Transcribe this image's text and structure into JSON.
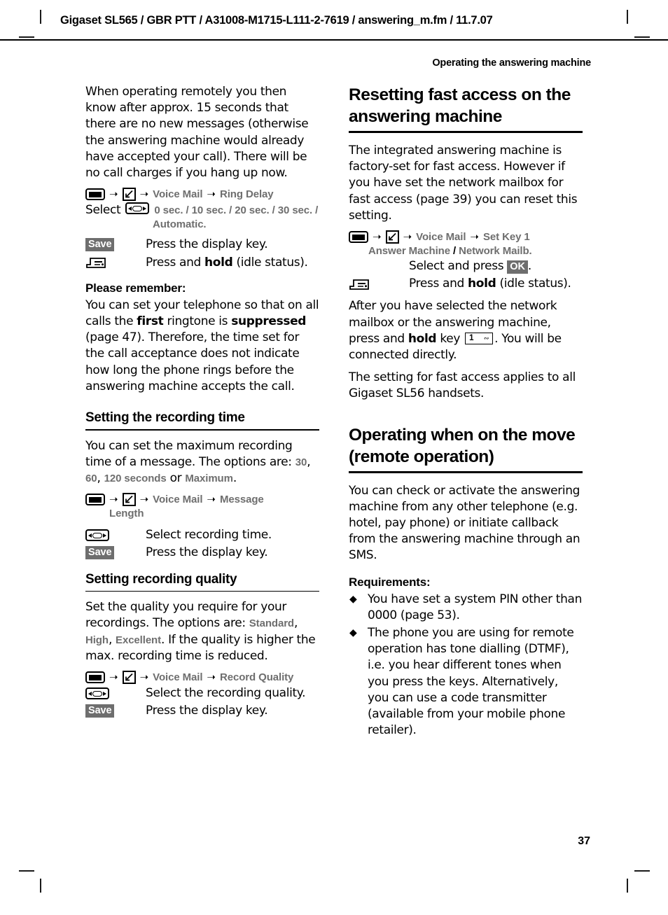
{
  "page": {
    "header_line": "Gigaset SL565 / GBR PTT / A31008-M1715-L111-2-7619 / answering_m.fm / 11.7.07",
    "running_section": "Operating the answering machine",
    "page_number": "37"
  },
  "icons": {
    "menu_key": "menu-key-icon",
    "answering_machine": "answering-machine-icon",
    "rocker_key": "rocker-key-icon",
    "end_call_key": "end-call-key-icon",
    "key_1": "key-1-icon",
    "bullet": "◆",
    "arrow": "➜"
  },
  "colors": {
    "menu_term": "#6e6e6e",
    "key_badge_bg": "#6e6e6e",
    "key_badge_text": "#ffffff",
    "rule": "#000000"
  },
  "left_column": {
    "intro_paragraph": "When operating remotely you then know after approx. 15 seconds that there are no new messages (otherwise the answering machine would already have accepted your call). There will be no call charges if you hang up now.",
    "ring_delay_path": {
      "item1": "Voice Mail",
      "item2": "Ring Delay"
    },
    "ring_delay_select": {
      "label": "Select",
      "values": "0 sec. / 10 sec. / 20 sec. / 30 sec. /",
      "values_cont": "Automatic."
    },
    "save_step": {
      "key_label": "Save",
      "text": "Press the display key."
    },
    "hold_step": {
      "text_before": "Press and ",
      "text_bold": "hold",
      "text_after": " (idle status)."
    },
    "please_remember": {
      "heading": "Please remember:",
      "text_1": "You can set your telephone so that on all calls the ",
      "bold_1": "first",
      "text_2": " ringtone is ",
      "bold_2": "suppressed",
      "text_3": " (page 47). Therefore, the time set for the call acceptance does not indicate how long the phone rings before the answering machine accepts the call."
    },
    "recording_time": {
      "heading": "Setting the recording time",
      "text_1": "You can set the maximum recording time of a message. The options are: ",
      "opt_1": "30",
      "sep_1": ", ",
      "opt_2": "60",
      "sep_2": ", ",
      "opt_3": "120 seconds",
      "sep_3": " or ",
      "opt_4": "Maximum",
      "text_end": ".",
      "path": {
        "item1": "Voice Mail",
        "item2": "Message",
        "item2_cont": "Length"
      },
      "select_step": "Select recording time.",
      "save_step": {
        "key_label": "Save",
        "text": "Press the display key."
      }
    },
    "recording_quality": {
      "heading": "Setting recording quality",
      "text_1": "Set the quality you require for your recordings. The options are: ",
      "opt_1": "Standard",
      "sep_1": ", ",
      "opt_2": "High",
      "sep_2": ", ",
      "opt_3": "Excellent",
      "text_end": ". If the quality is higher the max. recording time is reduced.",
      "path": {
        "item1": "Voice Mail",
        "item2": "Record Quality"
      },
      "select_step": "Select the recording quality.",
      "save_step": {
        "key_label": "Save",
        "text": "Press the display key."
      }
    }
  },
  "right_column": {
    "reset_fast_access": {
      "heading": "Resetting fast access on the answering machine",
      "paragraph": "The integrated answering machine is factory-set for fast access. However if you have set the network mailbox for fast access (page 39) you can reset this setting.",
      "path": {
        "item1": "Voice Mail",
        "item2": "Set Key 1",
        "item2_cont_a": "Answer Machine",
        "item2_cont_sep": " / ",
        "item2_cont_b": "Network Mailb."
      },
      "select_ok_step": {
        "text_before": "Select and press ",
        "key_label": "OK",
        "text_after": "."
      },
      "hold_step": {
        "text_before": "Press and ",
        "text_bold": "hold",
        "text_after": " (idle status)."
      },
      "after_paragraph_1": "After you have selected the network mailbox or the answering machine, press and ",
      "after_bold": "hold",
      "after_paragraph_2": " key ",
      "after_paragraph_3": ". You will be connected directly.",
      "final_paragraph": "The setting for fast access applies to all Gigaset SL56 handsets."
    },
    "remote_operation": {
      "heading": "Operating when on the move (remote operation)",
      "paragraph": "You can check or activate the answering machine from any other telephone (e.g. hotel, pay phone) or initiate callback from the answering machine through an SMS.",
      "requirements_heading": "Requirements:",
      "requirements": [
        "You have set a system PIN other than 0000 (page 53).",
        "The phone you are using for remote operation has tone dialling (DTMF), i.e. you hear different tones when you press the keys. Alternatively, you can use a code transmitter (available from your mobile phone retailer)."
      ]
    }
  }
}
